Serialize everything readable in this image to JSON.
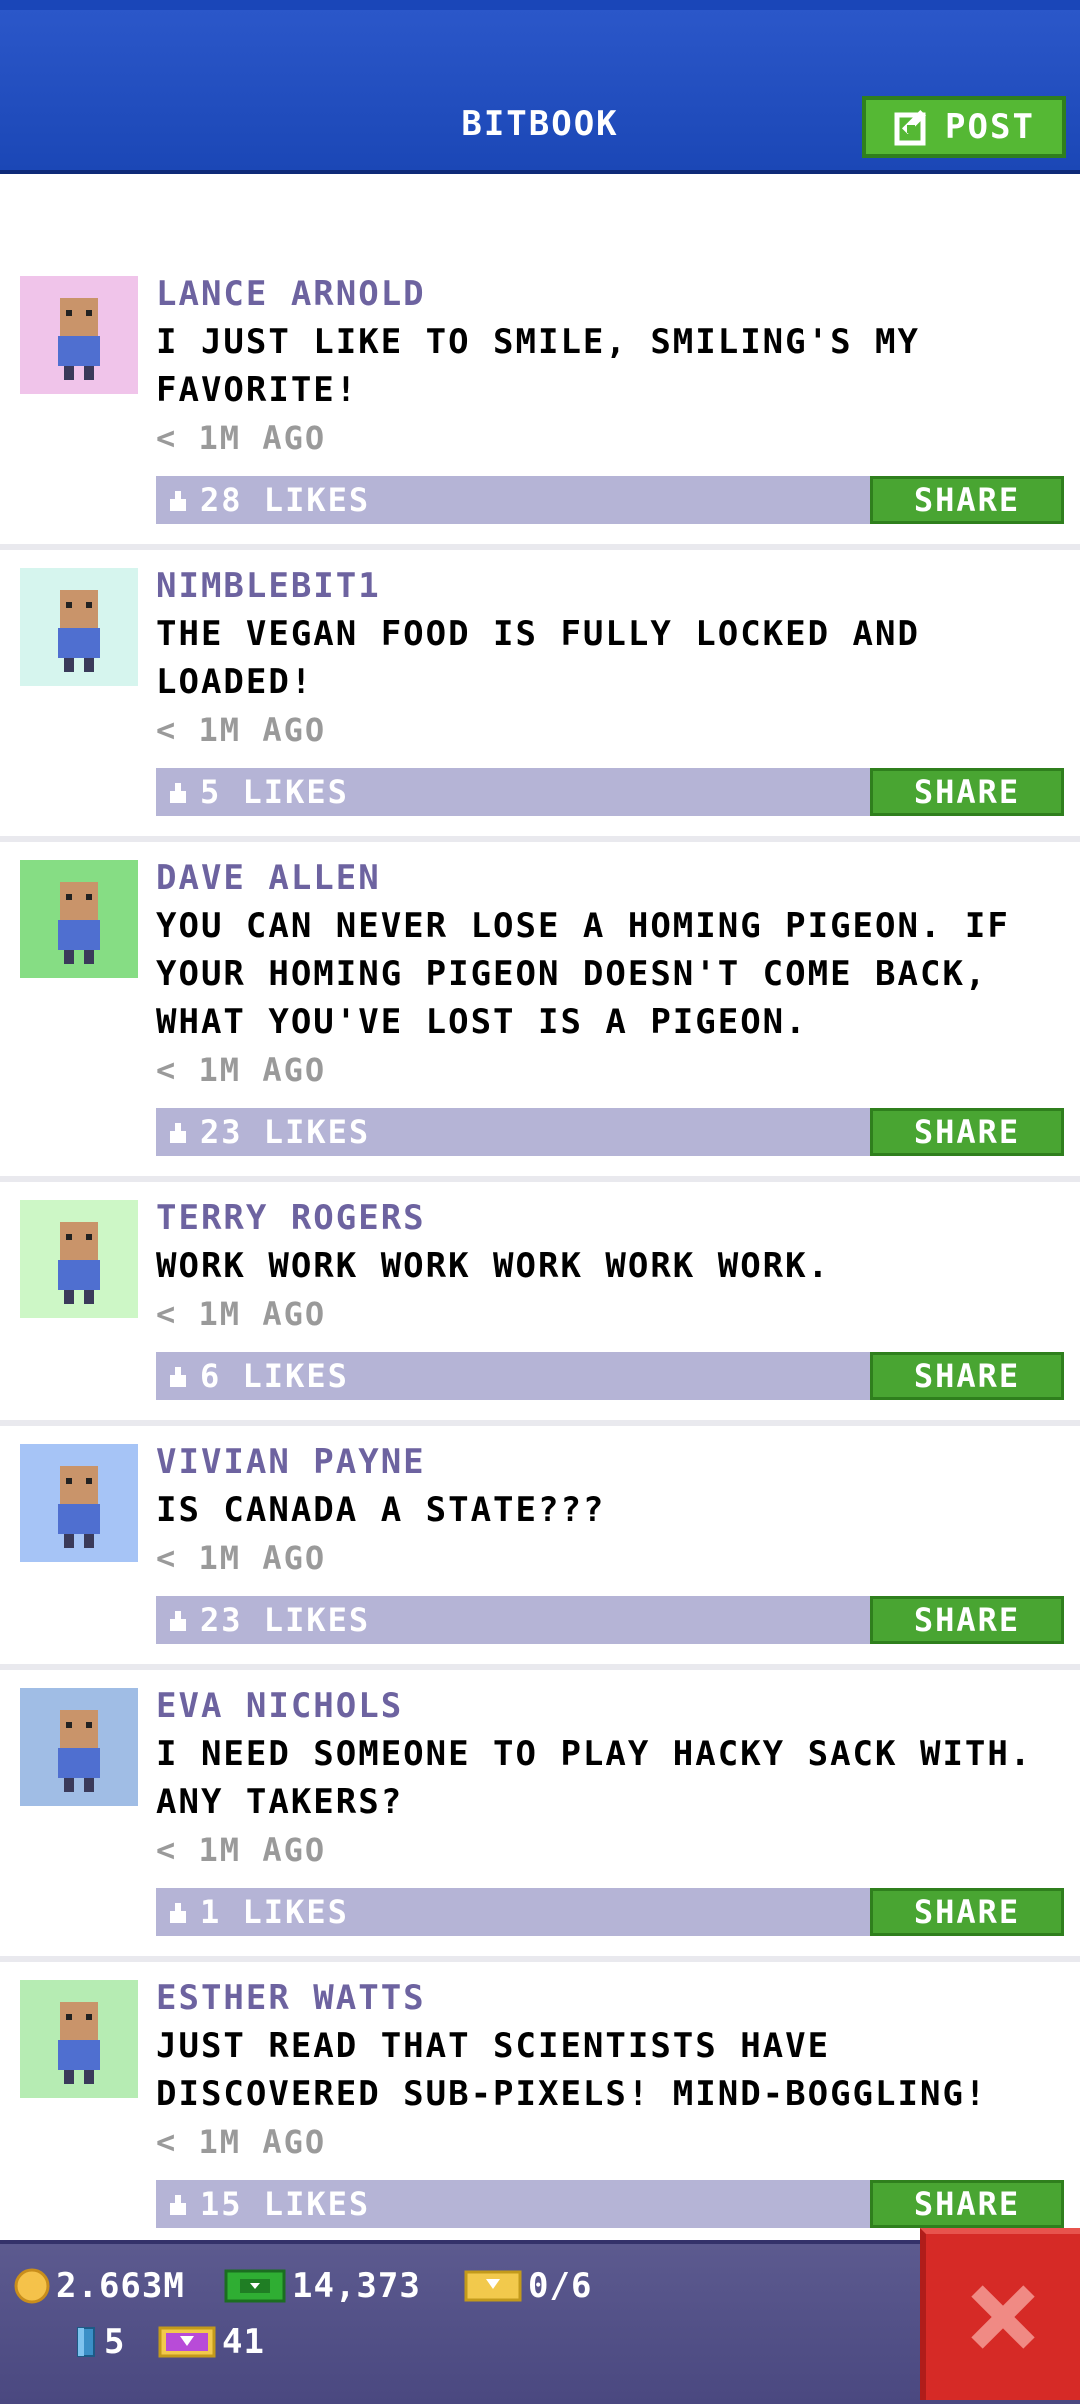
{
  "header": {
    "title": "BITBOOK",
    "post_label": "POST"
  },
  "colors": {
    "header_blue": "#1b47b6",
    "name_purple": "#6d63a0",
    "likes_bar": "#b5b4d6",
    "share_green": "#49a532",
    "close_red": "#d62a26"
  },
  "posts": [
    {
      "name": "LANCE ARNOLD",
      "text": "I JUST LIKE TO SMILE, SMILING'S MY FAVORITE!",
      "time": "< 1M AGO",
      "likes": "28 LIKES",
      "share": "SHARE",
      "avatar_bg": "#f0c4ea"
    },
    {
      "name": "NIMBLEBIT1",
      "text": "THE VEGAN FOOD IS FULLY LOCKED AND LOADED!",
      "time": "< 1M AGO",
      "likes": "5 LIKES",
      "share": "SHARE",
      "avatar_bg": "#d6f5ee"
    },
    {
      "name": "DAVE ALLEN",
      "text": "YOU CAN NEVER LOSE A HOMING PIGEON. IF YOUR HOMING PIGEON DOESN'T COME BACK, WHAT YOU'VE LOST IS A PIGEON.",
      "time": "< 1M AGO",
      "likes": "23 LIKES",
      "share": "SHARE",
      "avatar_bg": "#86dd84"
    },
    {
      "name": "TERRY ROGERS",
      "text": "WORK WORK WORK WORK WORK WORK.",
      "time": "< 1M AGO",
      "likes": "6 LIKES",
      "share": "SHARE",
      "avatar_bg": "#cdf7c6"
    },
    {
      "name": "VIVIAN PAYNE",
      "text": "IS CANADA A STATE???",
      "time": "< 1M AGO",
      "likes": "23 LIKES",
      "share": "SHARE",
      "avatar_bg": "#a6c4f6"
    },
    {
      "name": "EVA NICHOLS",
      "text": "I NEED SOMEONE TO PLAY HACKY SACK WITH. ANY TAKERS?",
      "time": "< 1M AGO",
      "likes": "1 LIKES",
      "share": "SHARE",
      "avatar_bg": "#a0bde5"
    },
    {
      "name": "ESTHER WATTS",
      "text": "JUST READ THAT SCIENTISTS HAVE DISCOVERED SUB-PIXELS! MIND-BOGGLING!",
      "time": "< 1M AGO",
      "likes": "15 LIKES",
      "share": "SHARE",
      "avatar_bg": "#b6ecb3"
    }
  ],
  "stats": {
    "coins": "2.663M",
    "bux": "14,373",
    "tickets": "0/6",
    "blocks": "5",
    "special": "41"
  },
  "icons": {
    "post": "edit-icon",
    "like": "thumbs-up-icon",
    "coins": "coin-icon",
    "bux": "bux-icon",
    "tickets": "ticket-icon",
    "blocks": "block-icon",
    "special": "golden-ticket-icon",
    "close": "close-icon"
  }
}
